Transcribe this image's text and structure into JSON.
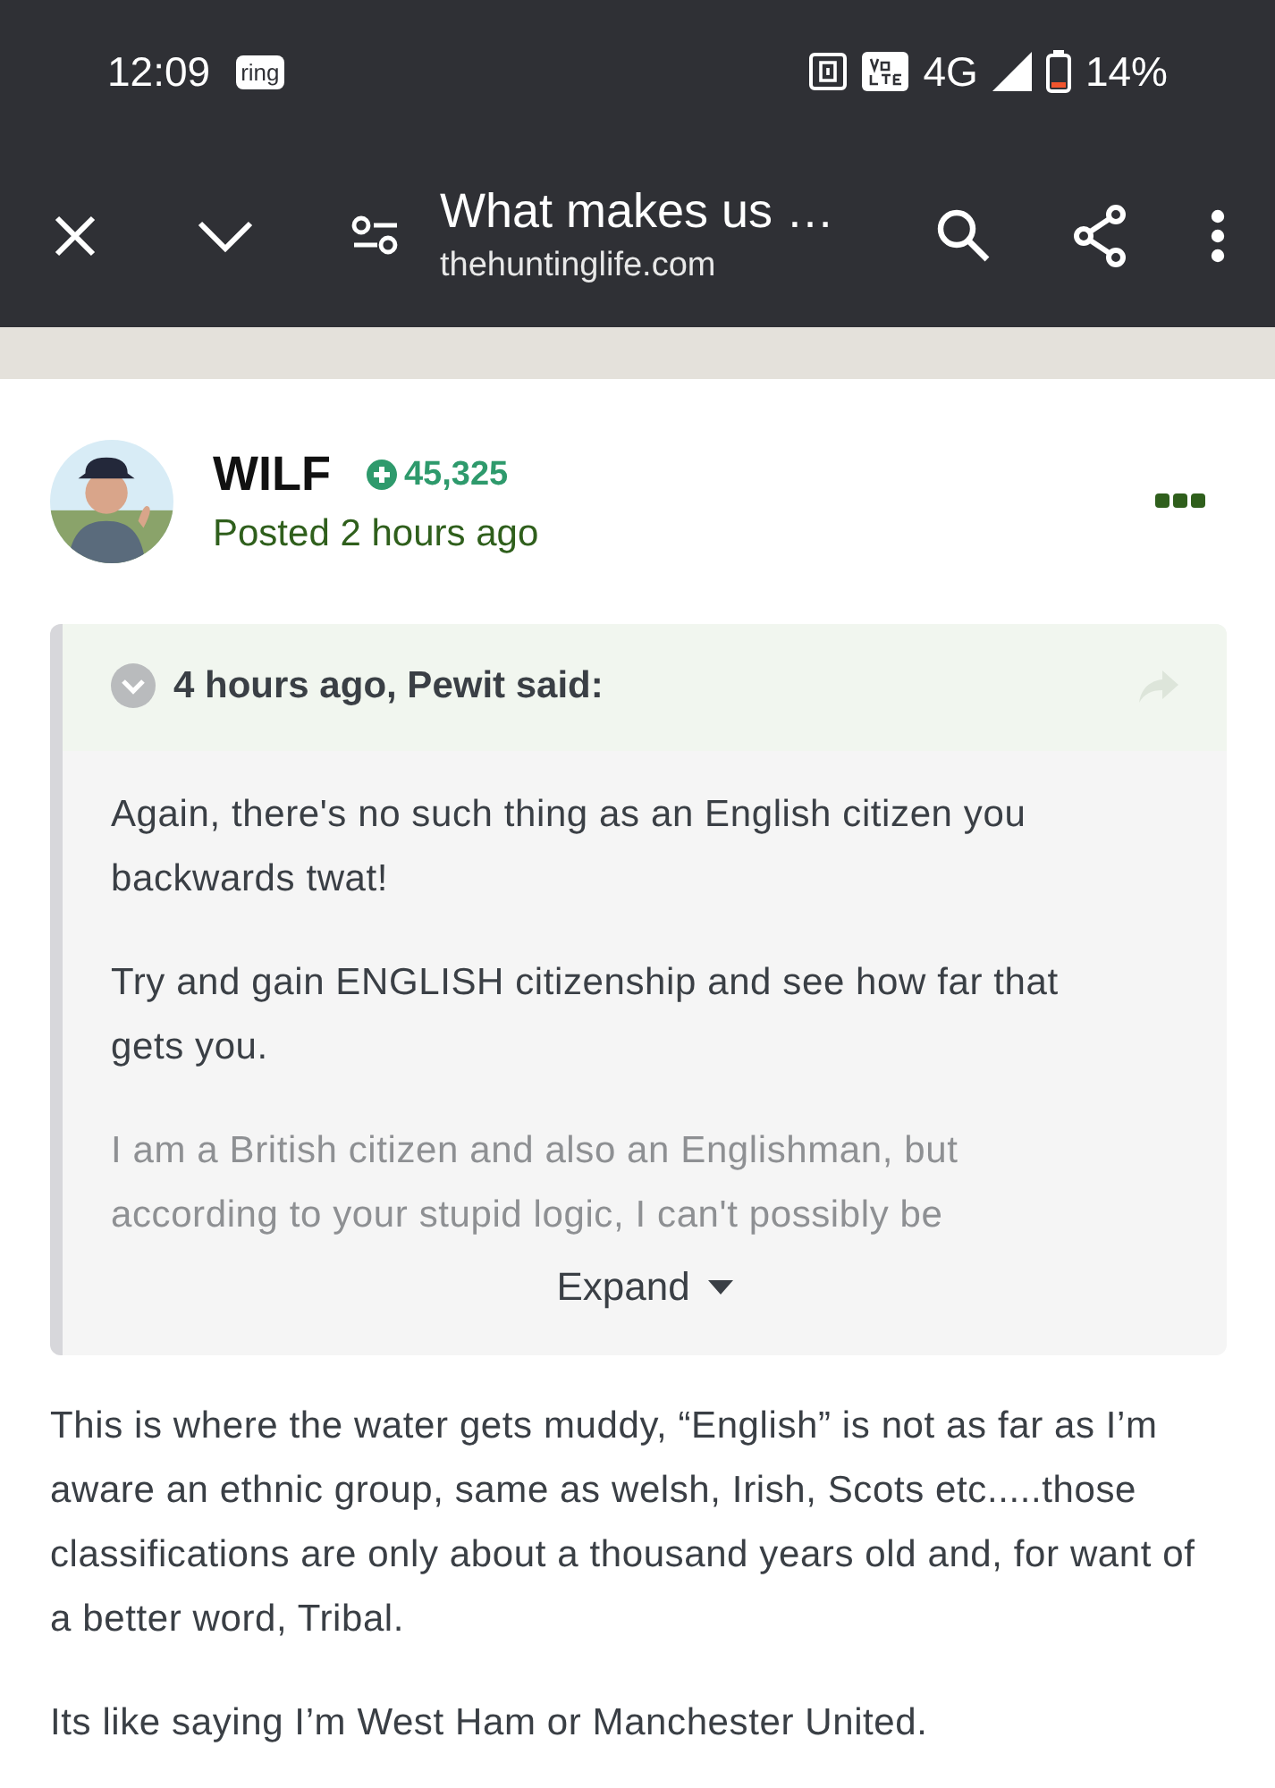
{
  "status_bar": {
    "time": "12:09",
    "notification_badge": "ring",
    "network": "4G",
    "battery_percent": "14%"
  },
  "toolbar": {
    "title": "What makes us …",
    "url": "thehuntinglife.com"
  },
  "post": {
    "author": "WILF",
    "reputation": "45,325",
    "posted": "Posted 2 hours ago",
    "quote": {
      "citation": "4 hours ago, Pewit said:",
      "paragraphs": [
        "Again, there's no such thing as an English citizen you backwards twat!",
        "Try and gain ENGLISH citizenship and see how far that gets you.",
        "I am a British citizen and also an Englishman, but according to your stupid logic, I can't possibly be"
      ],
      "expanded": false,
      "expand_label": "Expand"
    },
    "paragraphs": [
      "This is where the water gets muddy, “English” is not as far as I’m aware an ethnic group, same as welsh, Irish, Scots etc.....those classifications are only about a thousand years old and, for want of a better word, Tribal.",
      "Its like saying I’m West Ham or Manchester United."
    ]
  }
}
